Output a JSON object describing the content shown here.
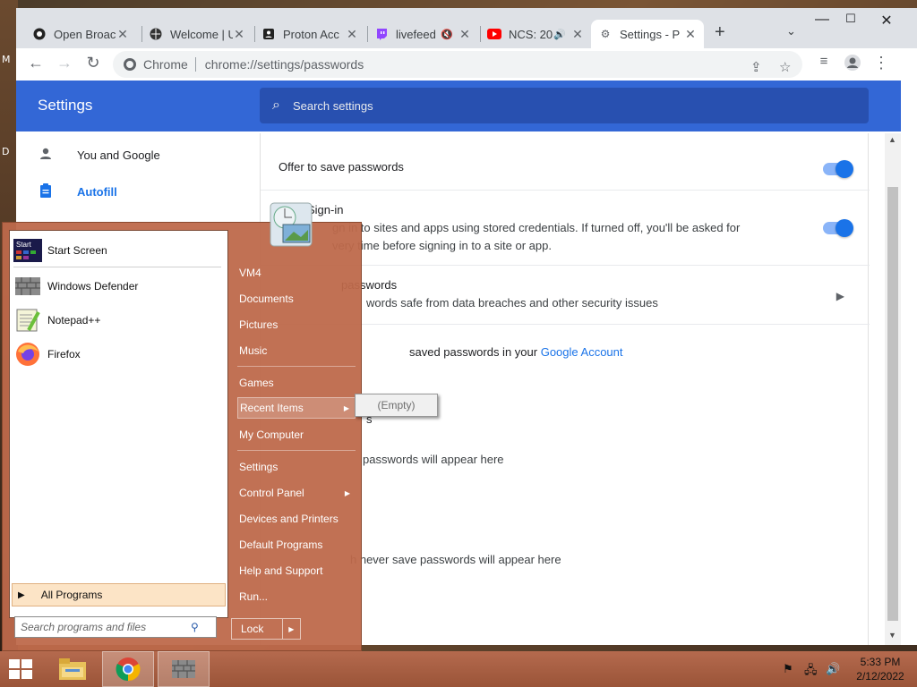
{
  "desktop": {
    "edge_letters": [
      "M",
      "D"
    ]
  },
  "browser": {
    "tabs": [
      {
        "label": "Open Broac",
        "icon": "obs-icon",
        "muted": false,
        "active": false
      },
      {
        "label": "Welcome | U",
        "icon": "globe-icon",
        "muted": false,
        "active": false
      },
      {
        "label": "Proton Acc",
        "icon": "proton-icon",
        "muted": false,
        "active": false
      },
      {
        "label": "livefeed",
        "icon": "twitch-icon",
        "muted": true,
        "active": false
      },
      {
        "label": "NCS: 20",
        "icon": "youtube-icon",
        "muted": false,
        "audio": true,
        "active": false
      },
      {
        "label": "Settings - P",
        "icon": "gear-icon",
        "muted": false,
        "active": true
      }
    ],
    "omnibox": {
      "site_label": "Chrome",
      "url": "chrome://settings/passwords"
    }
  },
  "settings": {
    "title": "Settings",
    "search_placeholder": "Search settings",
    "sidebar": [
      {
        "label": "You and Google",
        "icon": "person-icon",
        "active": false
      },
      {
        "label": "Autofill",
        "icon": "clipboard-icon",
        "active": true
      }
    ],
    "rows": {
      "offer_save": "Offer to save passwords",
      "autosignin_title": "Sign-in",
      "autosignin_line1": "gn in to sites and apps using stored credentials. If turned off, you'll be asked for",
      "autosignin_line2": "very time before signing in to a site or app.",
      "check_title": "passwords",
      "check_sub": "words safe from data breaches and other security issues",
      "google_account_prefix": "saved passwords in your",
      "google_account_link": "Google Account",
      "saved_title": "s",
      "saved_empty": "passwords will appear here",
      "never_empty": "h never save passwords will appear here"
    }
  },
  "start_menu": {
    "pinned": [
      {
        "label": "Start Screen",
        "icon": "start-screen-icon"
      },
      {
        "label": "Windows Defender",
        "icon": "windows-defender-icon"
      },
      {
        "label": "Notepad++",
        "icon": "notepad-plus-plus-icon"
      },
      {
        "label": "Firefox",
        "icon": "firefox-icon"
      }
    ],
    "all_programs": "All Programs",
    "search_placeholder": "Search programs and files",
    "right_items": [
      {
        "label": "VM4",
        "arrow": false
      },
      {
        "label": "Documents",
        "arrow": false
      },
      {
        "label": "Pictures",
        "arrow": false
      },
      {
        "label": "Music",
        "arrow": false
      },
      {
        "label": "Games",
        "arrow": false
      },
      {
        "label": "Recent Items",
        "arrow": true,
        "highlighted": true
      },
      {
        "label": "My Computer",
        "arrow": false
      },
      {
        "label": "Settings",
        "arrow": false
      },
      {
        "label": "Control Panel",
        "arrow": true
      },
      {
        "label": "Devices and Printers",
        "arrow": false
      },
      {
        "label": "Default Programs",
        "arrow": false
      },
      {
        "label": "Help and Support",
        "arrow": false
      },
      {
        "label": "Run...",
        "arrow": false
      }
    ],
    "lock_label": "Lock",
    "recent_submenu": "(Empty)"
  },
  "taskbar": {
    "apps": [
      "file-explorer-icon",
      "chrome-icon",
      "windows-defender-icon"
    ],
    "time": "5:33 PM",
    "date": "2/12/2022"
  }
}
